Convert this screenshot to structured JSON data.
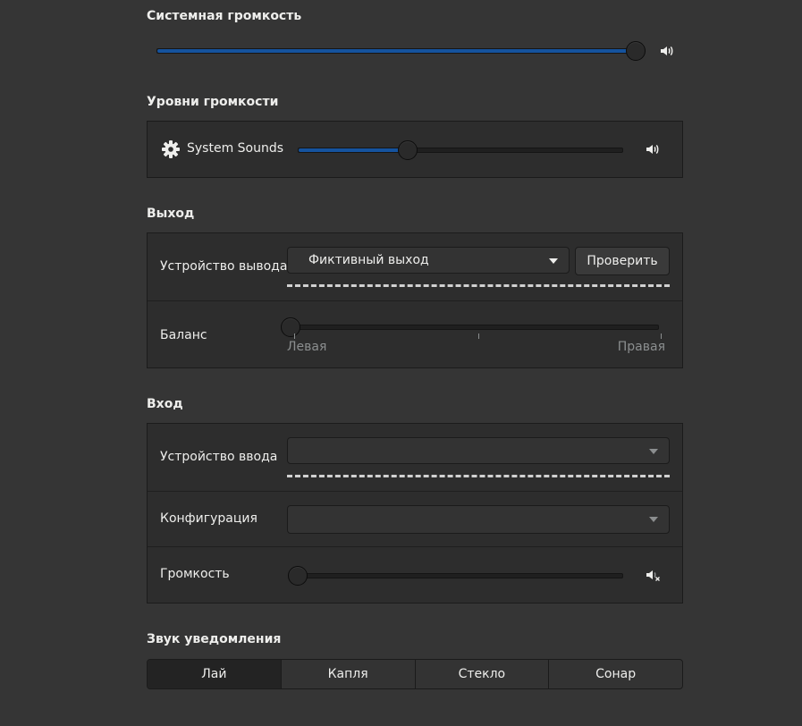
{
  "system_volume": {
    "title": "Системная громкость",
    "level": 1.0,
    "icon": "speaker-high-icon"
  },
  "volume_levels": {
    "title": "Уровни громкости",
    "app": {
      "label": "System Sounds",
      "icon": "gear-icon",
      "level": 0.34,
      "speaker_icon": "speaker-high-icon"
    }
  },
  "output": {
    "title": "Выход",
    "device_label": "Устройство вывода",
    "device_value": "Фиктивный выход",
    "test_button": "Проверить",
    "balance_label": "Баланс",
    "balance_left": "Левая",
    "balance_right": "Правая",
    "balance_level": 0.0
  },
  "input": {
    "title": "Вход",
    "device_label": "Устройство ввода",
    "device_value": "",
    "config_label": "Конфигурация",
    "config_value": "",
    "volume_label": "Громкость",
    "volume_level": 0.0,
    "speaker_icon": "speaker-muted-icon"
  },
  "alert_sound": {
    "title": "Звук уведомления",
    "options": [
      "Лай",
      "Капля",
      "Стекло",
      "Сонар"
    ],
    "selected": "Лай"
  },
  "colors": {
    "background": "#353535",
    "frame": "#2d2d2d",
    "accent": "#15539e"
  }
}
